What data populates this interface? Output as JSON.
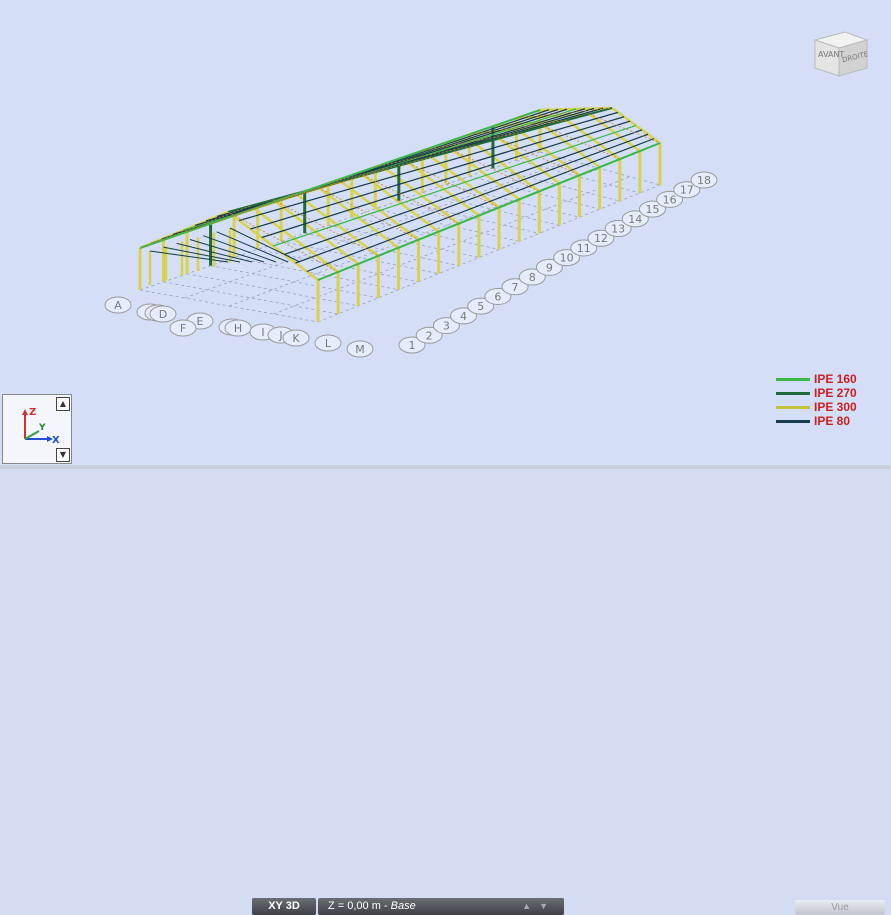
{
  "viewcube": {
    "front": "AVANT",
    "right": "DROITE"
  },
  "grid": {
    "letters": [
      "A",
      "B",
      "C",
      "D",
      "E",
      "F",
      "G",
      "H",
      "I",
      "J",
      "K",
      "L",
      "M"
    ],
    "numbers": [
      "1",
      "2",
      "3",
      "4",
      "5",
      "6",
      "7",
      "8",
      "9",
      "10",
      "11",
      "12",
      "13",
      "14",
      "15",
      "16",
      "17",
      "18"
    ]
  },
  "legend": [
    {
      "label": "IPE 160",
      "color": "#3ab84a"
    },
    {
      "label": "IPE 270",
      "color": "#1f6b3a"
    },
    {
      "label": "IPE 300",
      "color": "#c8c23a"
    },
    {
      "label": "IPE 80",
      "color": "#163d4a"
    }
  ],
  "triad": {
    "z": "Z",
    "y": "Y",
    "x": "X",
    "up": "▲",
    "down": "▼"
  },
  "status": {
    "view_mode": "XY 3D",
    "z_level": "Z = 0,00 m",
    "z_sep": " - ",
    "z_name": "Base",
    "arrows": "▲▼",
    "view_button": "Vue"
  },
  "colors": {
    "background": "#d4def6",
    "column": "#d9d24a",
    "rafter_light": "#3ab84a",
    "rafter_dark": "#1f6b3a",
    "purlin": "#163d4a",
    "brace": "#d08030"
  }
}
